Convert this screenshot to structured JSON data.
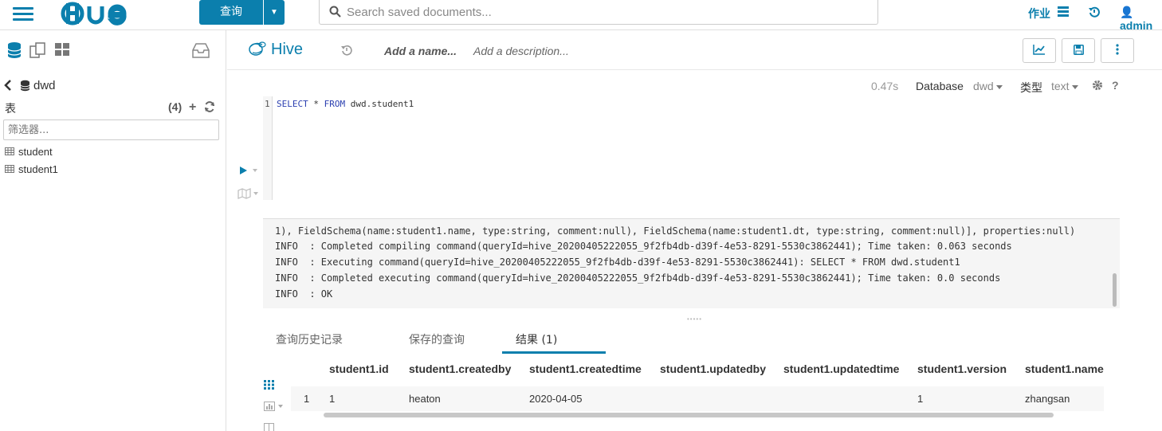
{
  "nav": {
    "logo_text": "HUE",
    "query_button": "查询",
    "search_placeholder": "Search saved documents...",
    "jobs_label": "作业",
    "user_label": "admin"
  },
  "left": {
    "database": "dwd",
    "tables_label": "表",
    "tables_count": "(4)",
    "filter_placeholder": "筛选器...",
    "tables": [
      "student",
      "student1"
    ]
  },
  "editor": {
    "engine": "Hive",
    "name_placeholder": "Add a name...",
    "description_placeholder": "Add a description...",
    "exec_time": "0.47s",
    "database_label": "Database",
    "database_value": "dwd",
    "type_label": "类型",
    "type_value": "text",
    "line_number": "1",
    "sql": "SELECT * FROM dwd.student1"
  },
  "log": {
    "lines": [
      "1), FieldSchema(name:student1.name, type:string, comment:null), FieldSchema(name:student1.dt, type:string, comment:null)], properties:null)",
      "INFO  : Completed compiling command(queryId=hive_20200405222055_9f2fb4db-d39f-4e53-8291-5530c3862441); Time taken: 0.063 seconds",
      "INFO  : Executing command(queryId=hive_20200405222055_9f2fb4db-d39f-4e53-8291-5530c3862441): SELECT * FROM dwd.student1",
      "INFO  : Completed executing command(queryId=hive_20200405222055_9f2fb4db-d39f-4e53-8291-5530c3862441); Time taken: 0.0 seconds",
      "INFO  : OK"
    ]
  },
  "tabs": {
    "history": "查询历史记录",
    "saved": "保存的查询",
    "results": "结果 (1)"
  },
  "results": {
    "columns": [
      "student1.id",
      "student1.createdby",
      "student1.createdtime",
      "student1.updatedby",
      "student1.updatedtime",
      "student1.version",
      "student1.name"
    ],
    "rows": [
      {
        "index": "1",
        "cells": [
          "1",
          "heaton",
          "2020-04-05",
          "",
          "",
          "1",
          "zhangsan"
        ]
      }
    ]
  },
  "colors": {
    "accent": "#0b7fad"
  }
}
